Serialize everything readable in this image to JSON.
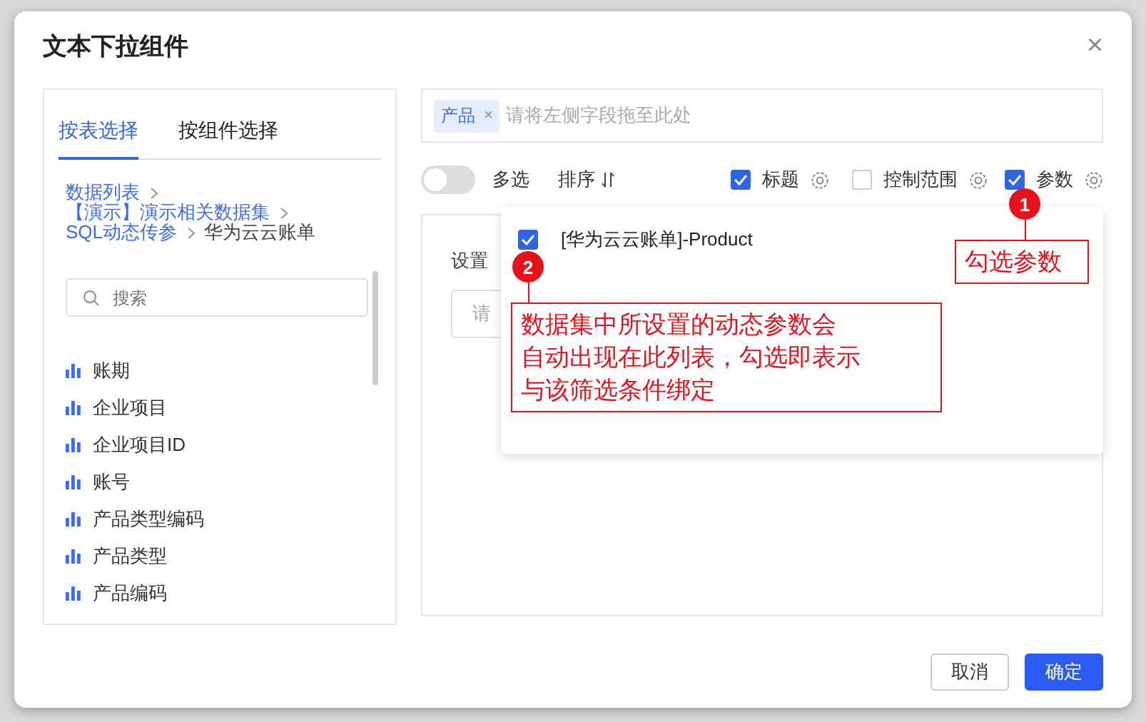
{
  "dialog": {
    "title": "文本下拉组件",
    "close": "×"
  },
  "left_panel": {
    "tabs": [
      {
        "label": "按表选择",
        "selected": true
      },
      {
        "label": "按组件选择",
        "selected": false
      }
    ],
    "breadcrumb": [
      {
        "label": "数据列表",
        "current": false
      },
      {
        "label": "【演示】演示相关数据集",
        "current": false
      },
      {
        "label": "SQL动态传参",
        "current": false
      },
      {
        "label": "华为云云账单",
        "current": true
      }
    ],
    "search": {
      "placeholder": "搜索"
    },
    "fields": [
      "账期",
      "企业项目",
      "企业项目ID",
      "账号",
      "产品类型编码",
      "产品类型",
      "产品编码"
    ]
  },
  "drop_field": {
    "tags": [
      {
        "label": "产品",
        "close": "×"
      }
    ],
    "placeholder": "请将左侧字段拖至此处"
  },
  "options": {
    "multi_select": {
      "label": "多选",
      "on": false
    },
    "sort": {
      "label": "排序"
    },
    "checks": [
      {
        "label": "标题",
        "checked": true
      },
      {
        "label": "控制范围",
        "checked": false
      },
      {
        "label": "参数",
        "checked": true
      }
    ]
  },
  "default_value": {
    "label": "设置",
    "placeholder": "请"
  },
  "param_popup": {
    "items": [
      {
        "label": "[华为云云账单]-Product",
        "checked": true
      }
    ]
  },
  "annotations": [
    {
      "number": "1",
      "lines": [
        "勾选参数"
      ]
    },
    {
      "number": "2",
      "lines": [
        "数据集中所设置的动态参数会",
        "自动出现在此列表，勾选即表示",
        "与该筛选条件绑定"
      ]
    }
  ],
  "buttons": [
    {
      "label": "取消",
      "kind": "secondary"
    },
    {
      "label": "确定",
      "kind": "primary"
    }
  ]
}
